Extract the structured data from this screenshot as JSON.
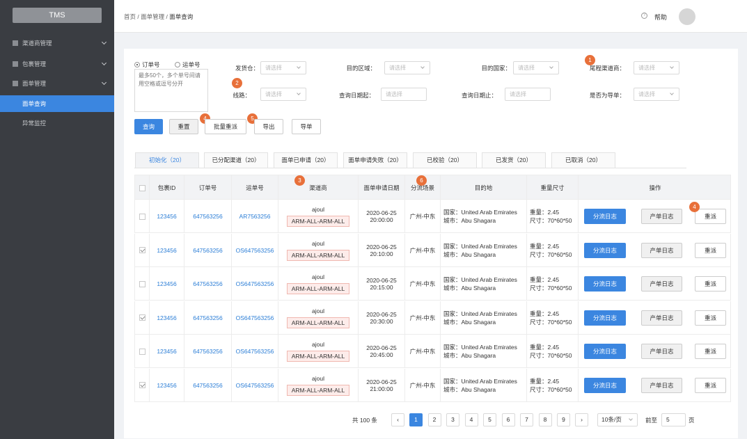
{
  "app": {
    "logo": "TMS"
  },
  "sidebar": {
    "groups": [
      {
        "label": "渠道商管理"
      },
      {
        "label": "包裹管理"
      },
      {
        "label": "面单管理"
      }
    ],
    "subitems": [
      {
        "label": "面单查询",
        "active": true
      },
      {
        "label": "异常监控",
        "active": false
      }
    ]
  },
  "header": {
    "breadcrumb": {
      "home": "首页",
      "sep": " / ",
      "mid": "面单管理",
      "current": "面单查询"
    },
    "help_icon": "?",
    "help": "帮助"
  },
  "search": {
    "radio_order": "订单号",
    "radio_waybill": "运单号",
    "textarea_placeholder": "最多50个，多个单号间请用空格或逗号分开",
    "fields": {
      "warehouse": {
        "label": "发货仓：",
        "placeholder": "请选择"
      },
      "region": {
        "label": "目的区域：",
        "placeholder": "请选择"
      },
      "country": {
        "label": "目的国家：",
        "placeholder": "请选择"
      },
      "last_mile": {
        "label": "尾程渠道商：",
        "placeholder": "请选择"
      },
      "route": {
        "label": "线路：",
        "placeholder": "请选择"
      },
      "date_from": {
        "label": "查询日期起：",
        "placeholder": "请选择"
      },
      "date_to": {
        "label": "查询日期止：",
        "placeholder": "请选择"
      },
      "is_export": {
        "label": "是否为导单：",
        "placeholder": "请选择"
      }
    },
    "buttons": {
      "query": "查询",
      "reset": "重置",
      "batch_retry": "批量重派",
      "export": "导出",
      "import": "导单"
    },
    "badges": [
      "1",
      "2",
      "4",
      "5"
    ]
  },
  "tabs": [
    {
      "label": "初始化（20）",
      "active": true
    },
    {
      "label": "已分配渠道（20）"
    },
    {
      "label": "面单已申请（20）"
    },
    {
      "label": "面单申请失败（20）"
    },
    {
      "label": "已校验（20）"
    },
    {
      "label": "已发货（20）"
    },
    {
      "label": "已取消（20）"
    }
  ],
  "table": {
    "headers": [
      "包裹ID",
      "订单号",
      "运单号",
      "渠道商",
      "面单申请日期",
      "分流场景",
      "目的地",
      "重量尺寸",
      "操作"
    ],
    "badges": {
      "channel": "3",
      "scene": "6",
      "op": "4"
    },
    "action_labels": {
      "log": "分流日志",
      "prod_log": "产单日志",
      "retry": "重派"
    },
    "rows": [
      {
        "checked": false,
        "pkg": "123456",
        "order": "647563256",
        "waybill": "AR7563256",
        "vendor": "ajoul",
        "vendor_tag": "ARM-ALL-ARM-ALL",
        "date": "2020-06-25",
        "time": "20:00:00",
        "scene": "广州-中东",
        "country": "国家：United Arab Emirates",
        "city": "城市：Abu Shagara",
        "weight": "重量：2.45",
        "size": "尺寸：70*60*50"
      },
      {
        "checked": true,
        "pkg": "123456",
        "order": "647563256",
        "waybill": "OS647563256",
        "vendor": "ajoul",
        "vendor_tag": "ARM-ALL-ARM-ALL",
        "date": "2020-06-25",
        "time": "20:10:00",
        "scene": "广州-中东",
        "country": "国家：United Arab Emirates",
        "city": "城市：Abu Shagara",
        "weight": "重量：2.45",
        "size": "尺寸：70*60*50"
      },
      {
        "checked": false,
        "pkg": "123456",
        "order": "647563256",
        "waybill": "OS647563256",
        "vendor": "ajoul",
        "vendor_tag": "ARM-ALL-ARM-ALL",
        "date": "2020-06-25",
        "time": "20:15:00",
        "scene": "广州-中东",
        "country": "国家：United Arab Emirates",
        "city": "城市：Abu Shagara",
        "weight": "重量：2.45",
        "size": "尺寸：70*60*50"
      },
      {
        "checked": true,
        "pkg": "123456",
        "order": "647563256",
        "waybill": "OS647563256",
        "vendor": "ajoul",
        "vendor_tag": "ARM-ALL-ARM-ALL",
        "date": "2020-06-25",
        "time": "20:30:00",
        "scene": "广州-中东",
        "country": "国家：United Arab Emirates",
        "city": "城市：Abu Shagara",
        "weight": "重量：2.45",
        "size": "尺寸：70*60*50"
      },
      {
        "checked": false,
        "pkg": "123456",
        "order": "647563256",
        "waybill": "OS647563256",
        "vendor": "ajoul",
        "vendor_tag": "ARM-ALL-ARM-ALL",
        "date": "2020-06-25",
        "time": "20:45:00",
        "scene": "广州-中东",
        "country": "国家：United Arab Emirates",
        "city": "城市：Abu Shagara",
        "weight": "重量：2.45",
        "size": "尺寸：70*60*50"
      },
      {
        "checked": true,
        "pkg": "123456",
        "order": "647563256",
        "waybill": "OS647563256",
        "vendor": "ajoul",
        "vendor_tag": "ARM-ALL-ARM-ALL",
        "date": "2020-06-25",
        "time": "21:00:00",
        "scene": "广州-中东",
        "country": "国家：United Arab Emirates",
        "city": "城市：Abu Shagara",
        "weight": "重量：2.45",
        "size": "尺寸：70*60*50"
      }
    ]
  },
  "pagination": {
    "total": "共 100 条",
    "prev": "‹",
    "next": "›",
    "pages": [
      "1",
      "2",
      "3",
      "4",
      "5",
      "6",
      "7",
      "8",
      "9"
    ],
    "current": "1",
    "page_size": "10条/页",
    "goto_label": "前至",
    "goto_value": "5",
    "goto_suffix": "页"
  },
  "colors": {
    "primary": "#3b86e0",
    "sidebar": "#3a3d42",
    "badge": "#e8703a"
  }
}
